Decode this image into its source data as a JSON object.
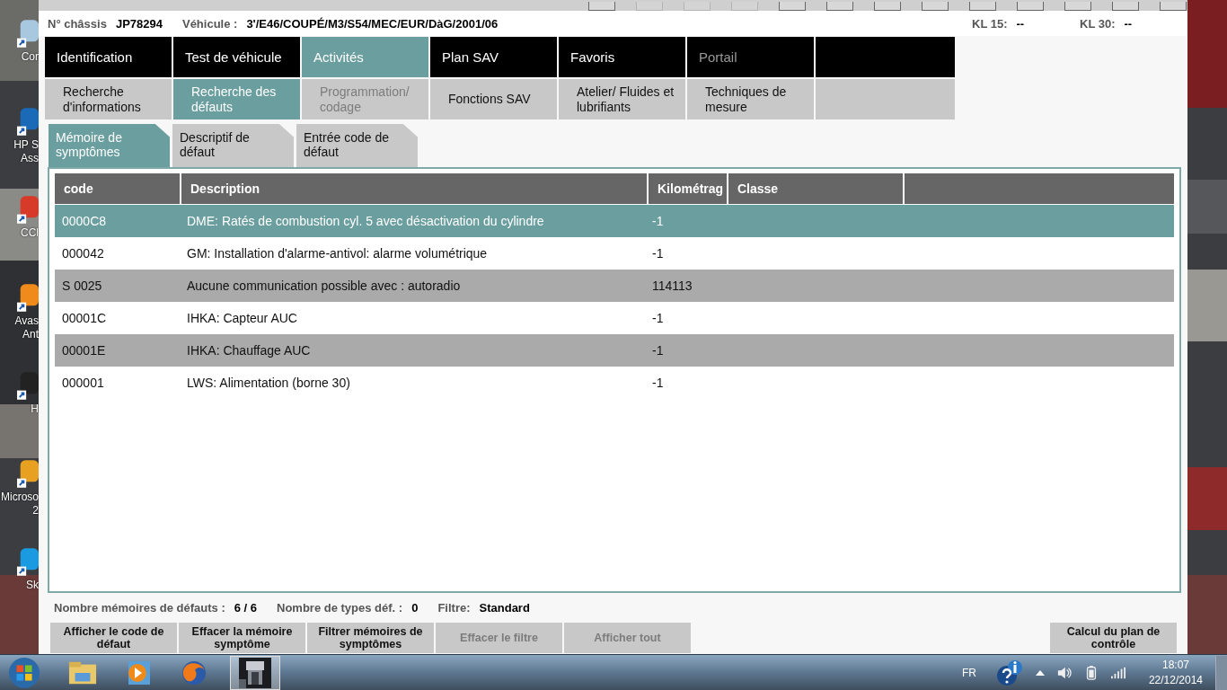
{
  "desktop_icons": [
    {
      "lines": [
        "Cor"
      ]
    },
    {
      "lines": [
        "HP S",
        "Ass"
      ]
    },
    {
      "lines": [
        "CCl"
      ]
    },
    {
      "lines": [
        "Avas",
        "Ant"
      ]
    },
    {
      "lines": [
        "H"
      ]
    },
    {
      "lines": [
        "Microso",
        "2"
      ]
    },
    {
      "lines": [
        "Sk"
      ]
    }
  ],
  "toolbar": [
    {
      "disabled": false
    },
    {
      "disabled": true
    },
    {
      "disabled": true
    },
    {
      "disabled": true
    },
    {
      "disabled": false
    },
    {
      "disabled": false
    },
    {
      "disabled": false
    },
    {
      "disabled": false
    },
    {
      "disabled": false
    },
    {
      "disabled": false
    },
    {
      "disabled": false
    },
    {
      "disabled": false
    },
    {
      "disabled": false
    }
  ],
  "vehicle_info": {
    "chassis_label": "N° châssis",
    "chassis": "JP78294",
    "vehicle_label": "Véhicule :",
    "vehicle": "3'/E46/COUPÉ/M3/S54/MEC/EUR/DàG/2001/06",
    "kl15_label": "KL 15:",
    "kl15": "--",
    "kl30_label": "KL 30:",
    "kl30": "--"
  },
  "main_tabs": [
    {
      "label": "Identification",
      "selected": false,
      "disabled": false
    },
    {
      "label": "Test de véhicule",
      "selected": false,
      "disabled": false
    },
    {
      "label": "Activités",
      "selected": true,
      "disabled": false
    },
    {
      "label": "Plan SAV",
      "selected": false,
      "disabled": false
    },
    {
      "label": "Favoris",
      "selected": false,
      "disabled": false
    },
    {
      "label": "Portail",
      "selected": false,
      "disabled": true
    }
  ],
  "sub_tabs": [
    {
      "label": "Recherche d'informations",
      "selected": false,
      "disabled": false
    },
    {
      "label": "Recherche des défauts",
      "selected": true,
      "disabled": false
    },
    {
      "label": "Programmation/ codage",
      "selected": false,
      "disabled": true
    },
    {
      "label": "Fonctions SAV",
      "selected": false,
      "disabled": false
    },
    {
      "label": "Atelier/ Fluides et lubrifiants",
      "selected": false,
      "disabled": false
    },
    {
      "label": "Techniques de mesure",
      "selected": false,
      "disabled": false
    }
  ],
  "view_tabs": [
    {
      "label": "Mémoire de symptômes",
      "selected": true
    },
    {
      "label": "Descriptif de défaut",
      "selected": false
    },
    {
      "label": "Entrée code de défaut",
      "selected": false
    }
  ],
  "table": {
    "columns": [
      "code",
      "Description",
      "Kilométrag",
      "Classe"
    ],
    "rows": [
      {
        "cells": [
          "0000C8",
          "DME: Ratés de combustion cyl. 5 avec désactivation du cylindre",
          "-1"
        ],
        "selected": true
      },
      {
        "cells": [
          "000042",
          "GM: Installation d'alarme-antivol: alarme volumétrique",
          "-1"
        ],
        "selected": false
      },
      {
        "cells": [
          "S 0025",
          "Aucune communication possible avec : autoradio",
          "114113"
        ],
        "selected": false
      },
      {
        "cells": [
          "00001C",
          "IHKA: Capteur AUC",
          "-1"
        ],
        "selected": false
      },
      {
        "cells": [
          "00001E",
          "IHKA: Chauffage AUC",
          "-1"
        ],
        "selected": false
      },
      {
        "cells": [
          "000001",
          "LWS: Alimentation (borne 30)",
          "-1"
        ],
        "selected": false
      }
    ]
  },
  "summary": {
    "count_label": "Nombre mémoires de défauts :",
    "count": "6 / 6",
    "types_label": "Nombre de types déf. :",
    "types": "0",
    "filter_label": "Filtre:",
    "filter": "Standard"
  },
  "buttons": [
    {
      "label": "Afficher le code de défaut",
      "disabled": false
    },
    {
      "label": "Effacer la mémoire symptôme",
      "disabled": false
    },
    {
      "label": "Filtrer mémoires de symptômes",
      "disabled": false
    },
    {
      "label": "Effacer le filtre",
      "disabled": true
    },
    {
      "label": "Afficher tout",
      "disabled": true
    }
  ],
  "right_button": {
    "label": "Calcul du plan de contrôle",
    "disabled": false
  },
  "taskbar": {
    "language": "FR",
    "time": "18:07",
    "date": "22/12/2014"
  }
}
